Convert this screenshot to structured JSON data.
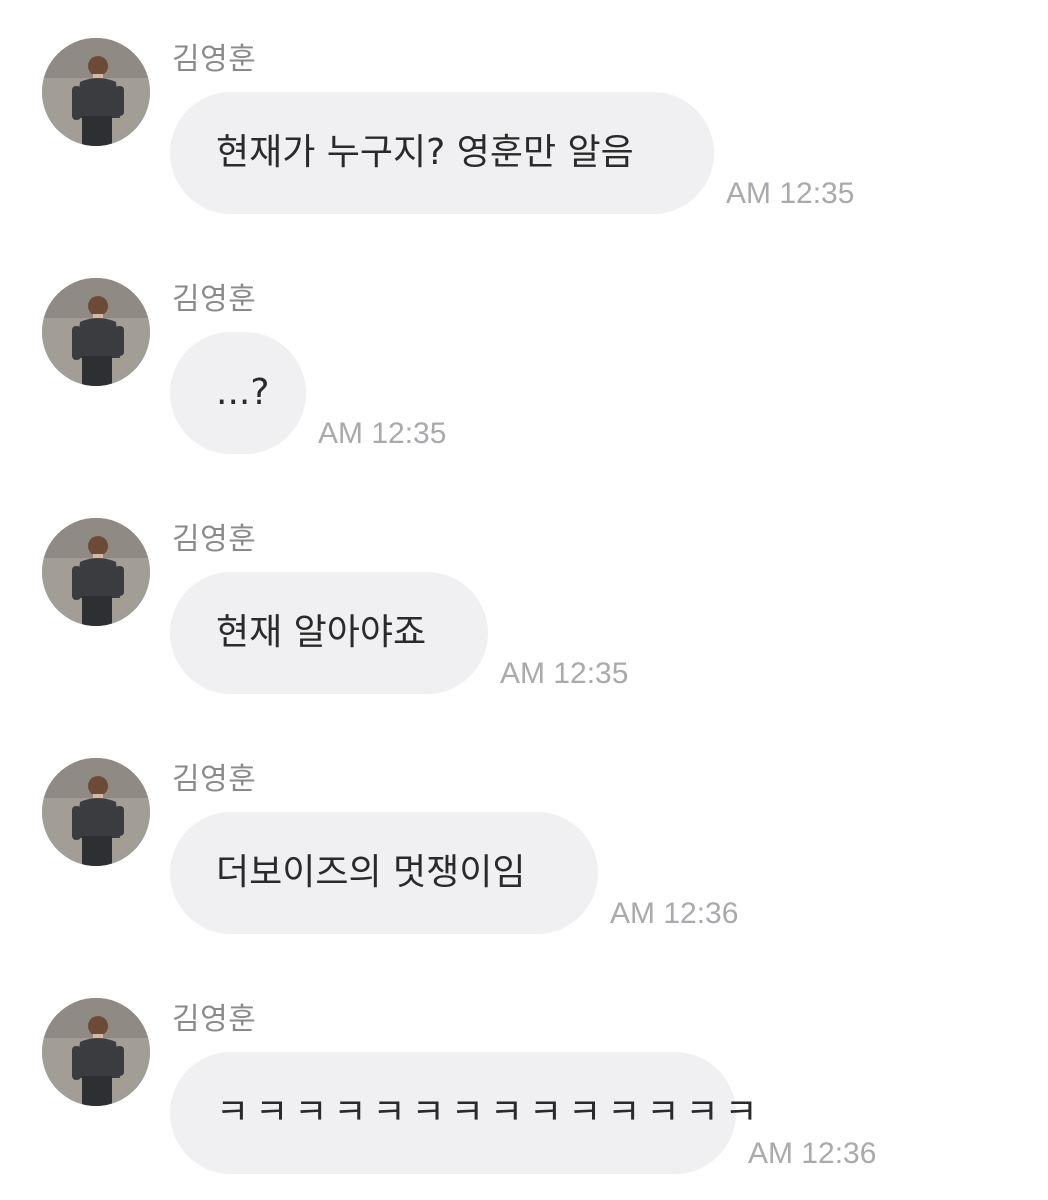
{
  "messages": [
    {
      "sender": "김영훈",
      "text": "현재가 누구지? 영훈만 알음",
      "time": "AM 12:35"
    },
    {
      "sender": "김영훈",
      "text": "...?",
      "time": "AM 12:35"
    },
    {
      "sender": "김영훈",
      "text": "현재 알아야죠",
      "time": "AM 12:35"
    },
    {
      "sender": "김영훈",
      "text": "더보이즈의 멋쟁이임",
      "time": "AM 12:36"
    },
    {
      "sender": "김영훈",
      "text": "ㅋㅋㅋㅋㅋㅋㅋㅋㅋㅋㅋㅋㅋㅋ",
      "time": "AM 12:36"
    }
  ],
  "colors": {
    "bubble": "#f0f0f2",
    "sender": "#8a8a8a",
    "time": "#a9a9ae",
    "text": "#2a2a2a"
  },
  "icons": {
    "avatar": "profile-photo"
  }
}
